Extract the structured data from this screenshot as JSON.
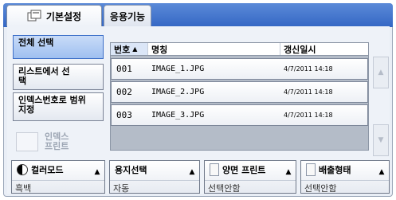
{
  "tabs": [
    {
      "label": "기본설정"
    },
    {
      "label": "응용기능"
    }
  ],
  "left_menu": {
    "select_all": "전체 선택",
    "select_from_list": "리스트에서 선택",
    "index_range": "인덱스번호로 범위 지정",
    "index_print": "인덱스 프린트"
  },
  "table": {
    "headers": {
      "no": "번호",
      "name": "명칭",
      "date": "갱신일시"
    },
    "rows": [
      {
        "no": "001",
        "name": "IMAGE_1.JPG",
        "date": "4/7/2011  14:18"
      },
      {
        "no": "002",
        "name": "IMAGE_2.JPG",
        "date": "4/7/2011  14:18"
      },
      {
        "no": "003",
        "name": "IMAGE_3.JPG",
        "date": "4/7/2011  14:18"
      }
    ]
  },
  "bottom": {
    "color_mode": {
      "title": "컬러모드",
      "value": "흑백"
    },
    "paper": {
      "title": "용지선택",
      "value": "자동"
    },
    "duplex": {
      "title": "양면 프린트",
      "value": "선택안함"
    },
    "output": {
      "title": "배출형태",
      "value": "선택안함"
    }
  },
  "colors": {
    "tab_bar": "#3467c4",
    "selected_button": "#9fc0f0"
  }
}
